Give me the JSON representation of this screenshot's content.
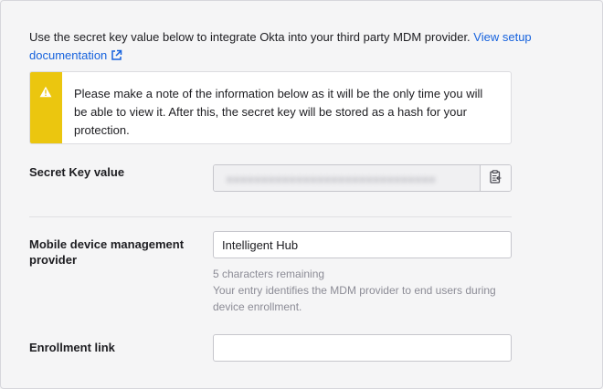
{
  "intro": {
    "text": "Use the secret key value below to integrate Okta into your third party MDM provider.",
    "link_label": "View setup documentation",
    "link_icon": "external-link-icon"
  },
  "callout": {
    "icon": "warning-icon",
    "accent_color": "#ebc60f",
    "text": "Please make a note of the information below as it will be the only time you will be able to view it. After this, the secret key will be stored as a hash for your protection."
  },
  "secret_key": {
    "label": "Secret Key value",
    "copy_icon": "clipboard-icon"
  },
  "mdm_provider": {
    "label": "Mobile device management provider",
    "value": "Intelligent Hub",
    "remaining": "5 characters remaining",
    "help": "Your entry identifies the MDM provider to end users during device enrollment."
  },
  "enrollment": {
    "label": "Enrollment link",
    "value": ""
  }
}
